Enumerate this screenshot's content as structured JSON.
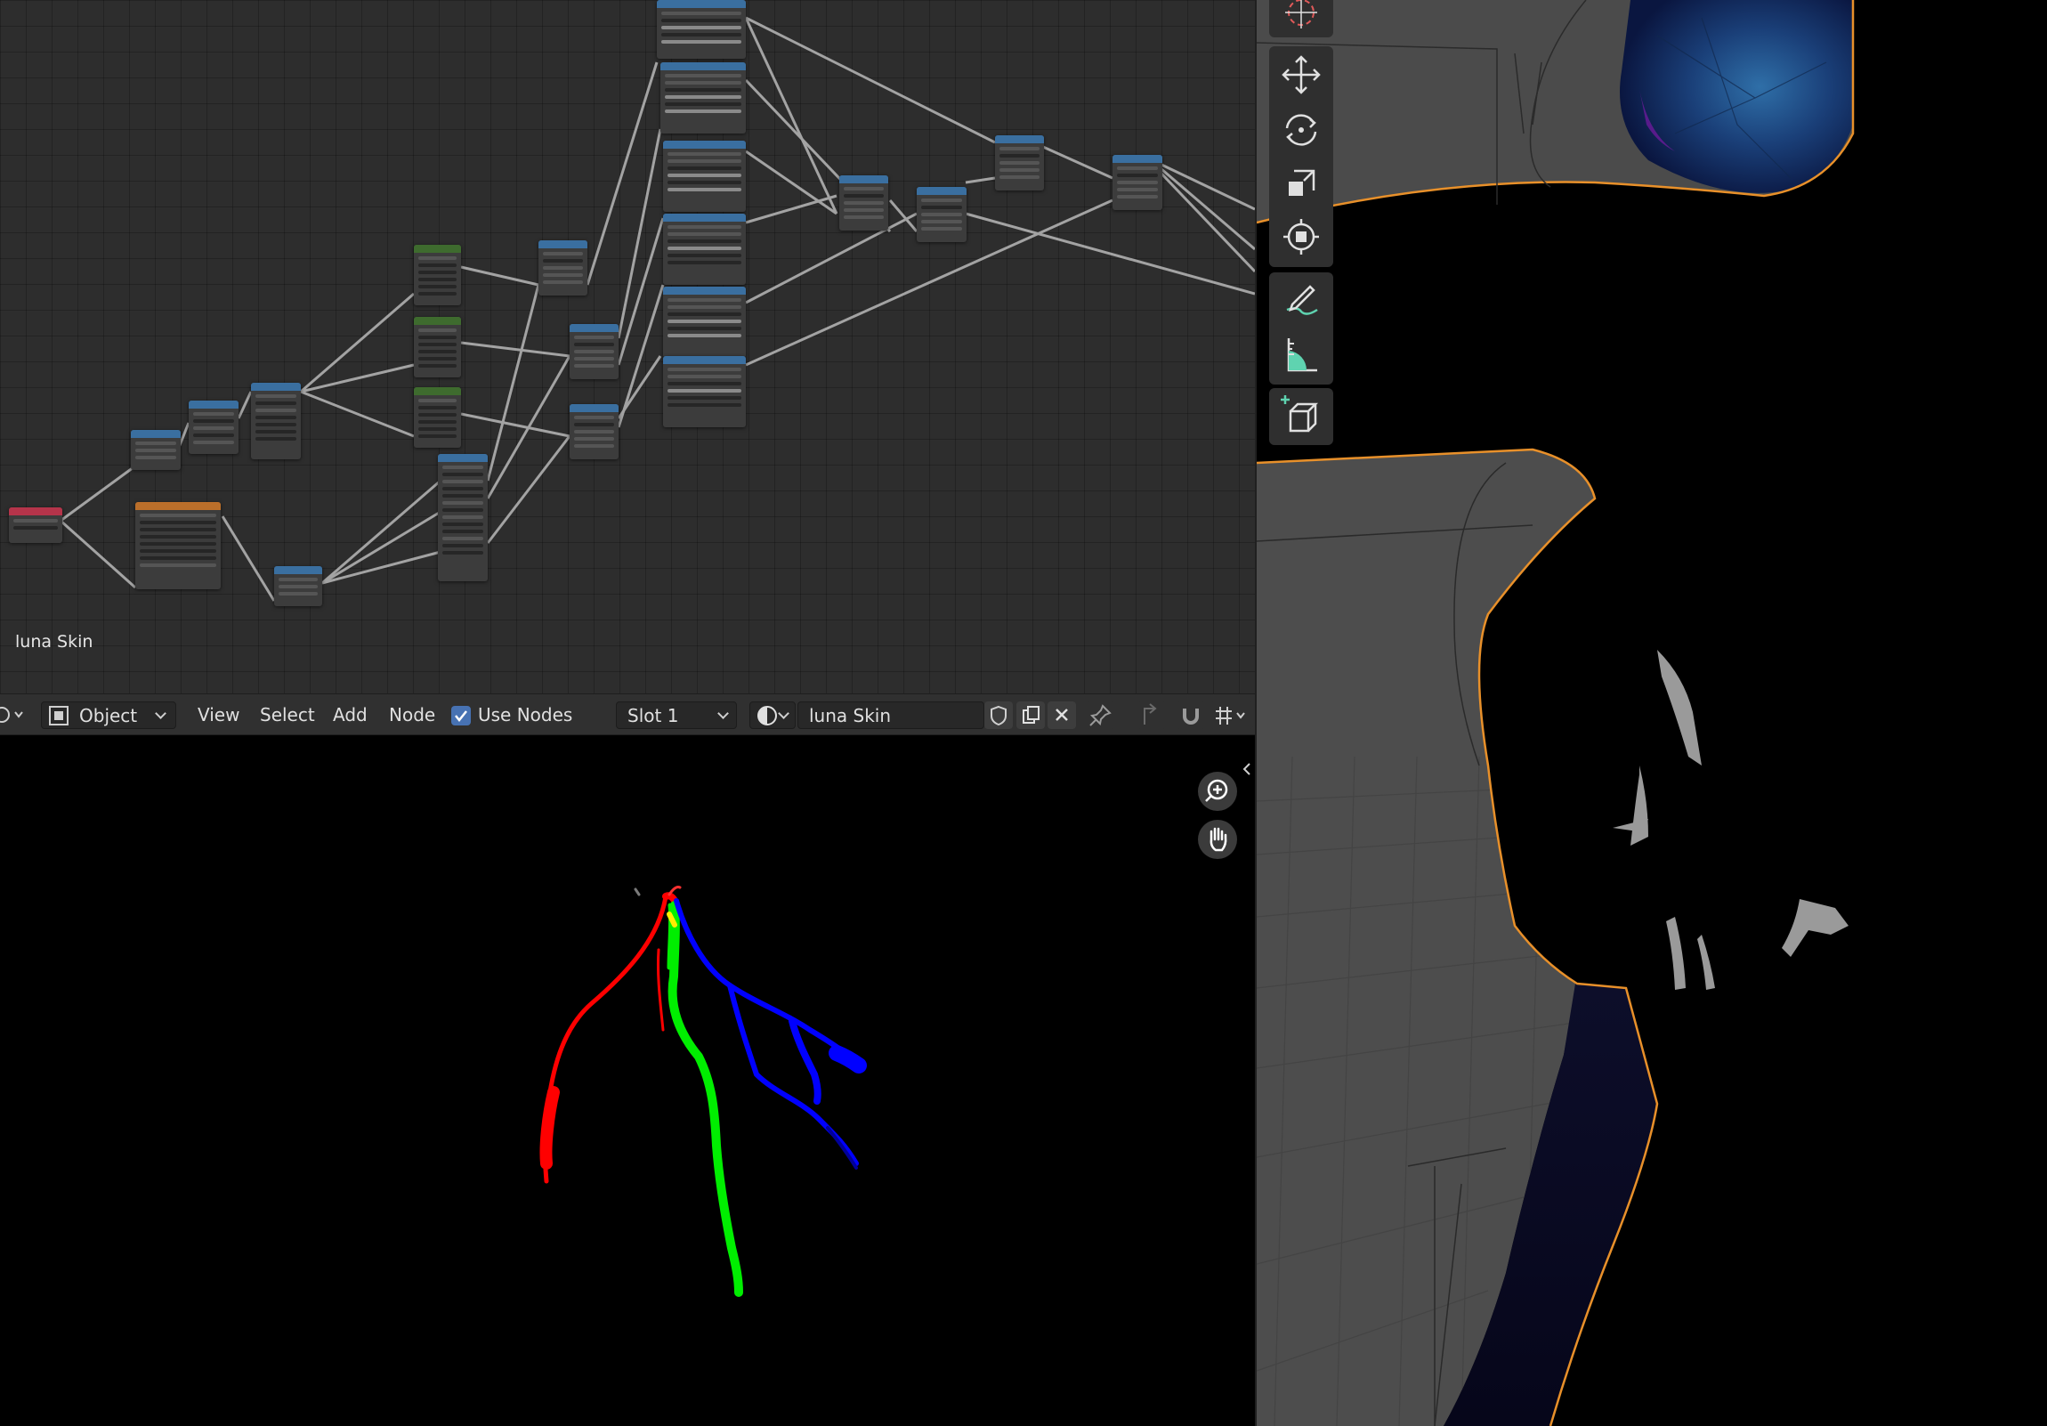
{
  "node_editor": {
    "material_label": "luna Skin"
  },
  "header": {
    "mode_label": "Object",
    "menus": [
      "View",
      "Select",
      "Add",
      "Node"
    ],
    "use_nodes_label": "Use Nodes",
    "use_nodes_checked": true,
    "slot_label": "Slot 1",
    "material_name": "luna Skin"
  },
  "colors": {
    "accent": "#4772b3",
    "node_converter": "#3a6fa0",
    "node_texture": "#bb6f2a",
    "node_input": "#b5344a",
    "node_voronoi": "#3e6b2e",
    "selection_outline": "#e8902a",
    "channel_red": "#ff0000",
    "channel_green": "#00ee00",
    "channel_blue": "#0000ff"
  },
  "icons": {
    "zoom": "zoom-in-icon",
    "pan": "hand-icon",
    "tools": [
      "cursor-icon",
      "move-icon",
      "rotate-icon",
      "scale-icon",
      "transform-icon",
      "annotate-icon",
      "measure-icon",
      "add-cube-icon"
    ]
  }
}
